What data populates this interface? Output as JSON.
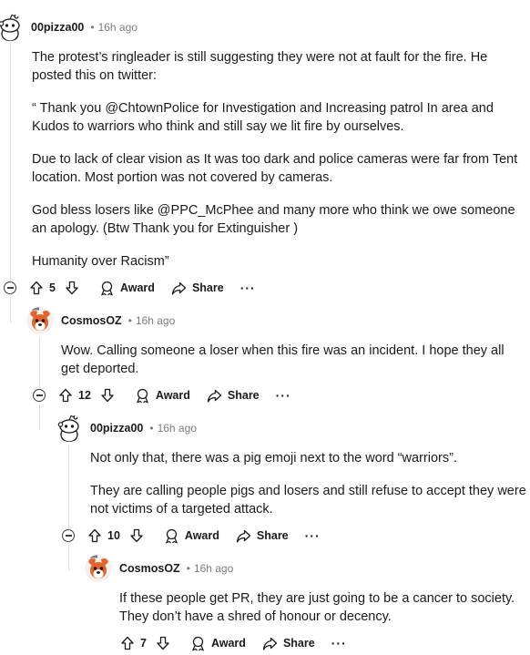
{
  "comments": [
    {
      "author": "00pizza00",
      "separator": "•",
      "time": "16h ago",
      "avatar": "snoo-icon",
      "paragraphs": [
        "The protest’s ringleader is still suggesting they were not at fault for the fire. He posted this on twitter:",
        "“ Thank you @ChtownPolice for Investigation and Increasing patrol In area and Kudos to warriors who think and still say we lit fire by ourselves.",
        "Due to lack of clear vision as It was too dark and police cameras were far from Tent location. Most portion was not covered by cameras.",
        "God bless losers like @PPC_McPhee and many more who think we owe someone an apology. (Btw Thank you for Extinguisher )",
        "Humanity over Racism”"
      ],
      "votes": "5"
    },
    {
      "author": "CosmosOZ",
      "separator": "•",
      "time": "16h ago",
      "avatar": "dog-avatar-icon",
      "paragraphs": [
        "Wow. Calling someone a loser when this fire was an incident. I hope they all get deported."
      ],
      "votes": "12"
    },
    {
      "author": "00pizza00",
      "separator": "•",
      "time": "16h ago",
      "avatar": "snoo-icon",
      "paragraphs": [
        "Not only that, there was a pig emoji next to the word “warriors”.",
        "They are calling people pigs and losers and still refuse to accept they were not victims of a targeted attack."
      ],
      "votes": "10"
    },
    {
      "author": "CosmosOZ",
      "separator": "•",
      "time": "16h ago",
      "avatar": "dog-avatar-icon",
      "paragraphs": [
        "If these people get PR, they are just going to be a cancer to society. They don’t have a shred of honour or decency."
      ],
      "votes": "7"
    }
  ],
  "actions": {
    "award_label": "Award",
    "share_label": "Share",
    "more_label": "···"
  },
  "colors": {
    "text": "#1a1a1b",
    "meta": "#7c7c7c",
    "thread_line": "#d8dadc",
    "avatar_orange": "#e0642b"
  }
}
